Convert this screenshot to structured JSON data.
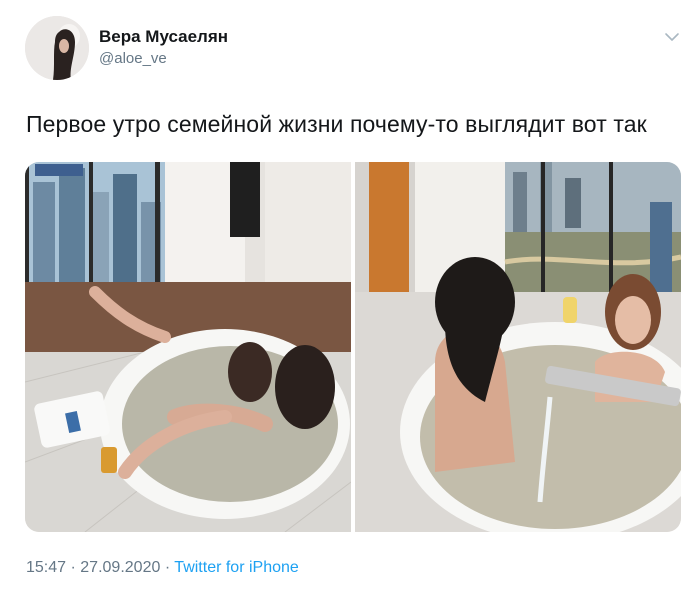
{
  "author": {
    "display_name": "Вера Мусаелян",
    "handle": "@aloe_ve",
    "avatar_icon": "profile-photo"
  },
  "menu": {
    "icon": "chevron-down-icon"
  },
  "tweet": {
    "text": "Первое утро семейной жизни почему-то выглядит вот так",
    "media": [
      {
        "icon": "photo-bathtub-two-women-left"
      },
      {
        "icon": "photo-bathtub-two-women-right"
      }
    ]
  },
  "meta": {
    "time": "15:47",
    "separator": "·",
    "date": "27.09.2020",
    "source": "Twitter for iPhone"
  },
  "colors": {
    "text": "#14171a",
    "secondary": "#657786",
    "link": "#1da1f2",
    "background": "#ffffff"
  }
}
